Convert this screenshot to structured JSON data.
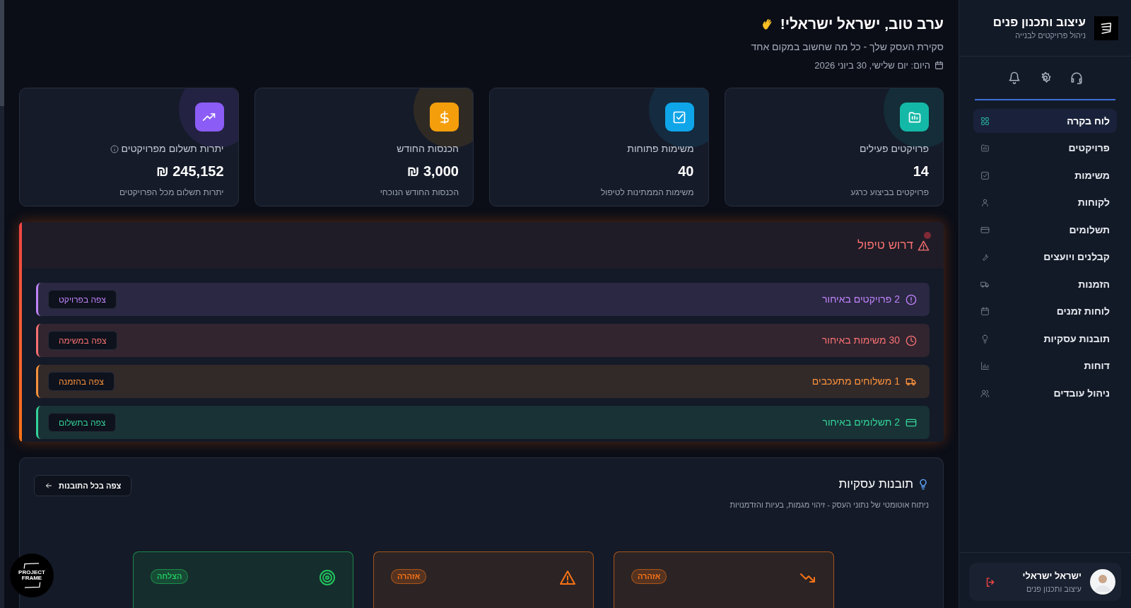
{
  "sidebar": {
    "brand": {
      "title": "עיצוב ותכנון פנים",
      "subtitle": "ניהול פרויקטים לבנייה"
    },
    "toolbar": [
      {
        "kind": "headset"
      },
      {
        "kind": "gear"
      },
      {
        "kind": "bell"
      }
    ],
    "items": [
      {
        "label": "לוח בקרה",
        "kind": "grid",
        "selected": true
      },
      {
        "label": "פרויקטים",
        "kind": "folder",
        "selected": false
      },
      {
        "label": "משימות",
        "kind": "check",
        "selected": false
      },
      {
        "label": "לקוחות",
        "kind": "user",
        "selected": false
      },
      {
        "label": "תשלומים",
        "kind": "card",
        "selected": false
      },
      {
        "label": "קבלנים ויועצים",
        "kind": "wrench",
        "selected": false
      },
      {
        "label": "הזמנות",
        "kind": "truck",
        "selected": false
      },
      {
        "label": "לוחות זמנים",
        "kind": "calendar",
        "selected": false
      },
      {
        "label": "תובנות עסקיות",
        "kind": "bulb",
        "selected": false
      },
      {
        "label": "דוחות",
        "kind": "chart",
        "selected": false
      },
      {
        "label": "ניהול עובדים",
        "kind": "users",
        "selected": false
      }
    ],
    "user": {
      "name": "ישראל ישראלי",
      "role": "עיצוב ותכנון פנים"
    }
  },
  "header": {
    "greeting": "ערב טוב, ישראל ישראלי!",
    "subtitle": "סקירת העסק שלך - כל מה שחשוב במקום אחד",
    "date": "היום: יום שלישי, 30 ביוני 2026"
  },
  "stats": [
    {
      "title": "פרויקטים פעילים",
      "value": "14",
      "caption": "פרויקטים בביצוע כרגע",
      "kind": "folder",
      "color": "#14b8a6",
      "info": false
    },
    {
      "title": "משימות פתוחות",
      "value": "40",
      "caption": "משימות הממתינות לטיפול",
      "kind": "check",
      "color": "#0ea5e9",
      "info": false
    },
    {
      "title": "הכנסות החודש",
      "value": "3,000 ₪",
      "caption": "הכנסות החודש הנוכחי",
      "kind": "dollar",
      "color": "#f59e0b",
      "info": false
    },
    {
      "title": "יתרות תשלום מפרויקטים",
      "value": "245,152 ₪",
      "caption": "יתרות תשלום מכל הפרויקטים",
      "kind": "trend",
      "color": "#8b5cf6",
      "info": true
    }
  ],
  "attention": {
    "title": "דרוש טיפול",
    "items": [
      {
        "text": "2 פרויקטים באיחור",
        "kind": "alert",
        "color": "#c084fc",
        "button": "צפה בפרויקט"
      },
      {
        "text": "30 משימות באיחור",
        "kind": "clock",
        "color": "#f87171",
        "button": "צפה במשימה"
      },
      {
        "text": "1 משלוחים מתעכבים",
        "kind": "truck",
        "color": "#fb923c",
        "button": "צפה בהזמנה"
      },
      {
        "text": "2 תשלומים באיחור",
        "kind": "card",
        "color": "#34d399",
        "button": "צפה בתשלום"
      }
    ]
  },
  "insights": {
    "title": "תובנות עסקיות",
    "subtitle": "ניתוח אוטומטי של נתוני העסק - זיהוי מגמות, בעיות והזדמנויות",
    "button": "צפה בכל התובנות",
    "cards": [
      {
        "badge": "אזהרה",
        "kind": "trend-down",
        "color": "#f97316"
      },
      {
        "badge": "אזהרה",
        "kind": "warning",
        "color": "#f97316"
      },
      {
        "badge": "הצלחה",
        "kind": "target",
        "color": "#22c55e"
      }
    ]
  },
  "floating_logo": {
    "text": "PROJECT FRAME"
  }
}
